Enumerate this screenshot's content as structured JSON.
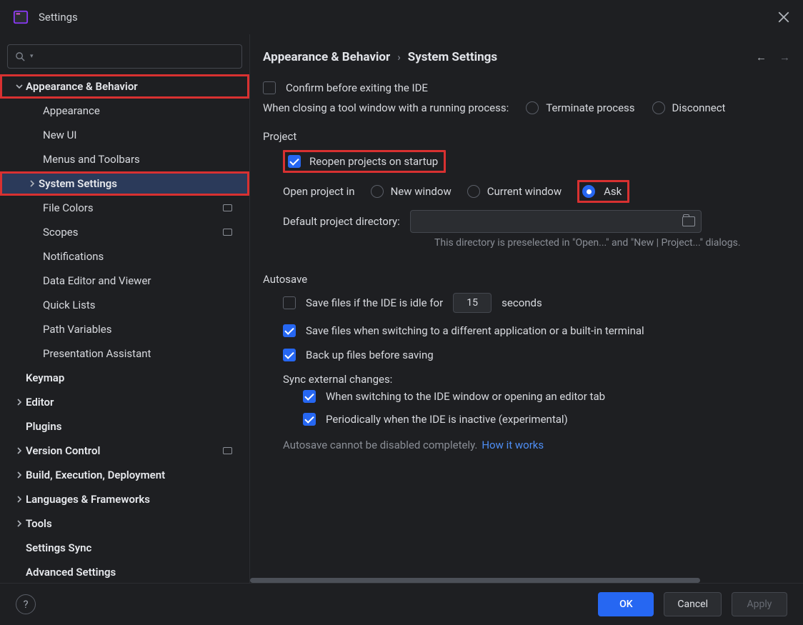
{
  "window": {
    "title": "Settings"
  },
  "sidebar": {
    "items": [
      {
        "label": "Appearance & Behavior",
        "level": 0,
        "chevron": "down",
        "highlight": true
      },
      {
        "label": "Appearance",
        "level": 1
      },
      {
        "label": "New UI",
        "level": 1
      },
      {
        "label": "Menus and Toolbars",
        "level": 1
      },
      {
        "label": "System Settings",
        "level": 1,
        "chevron": "right",
        "selected": true,
        "highlight": true,
        "boldchev": true
      },
      {
        "label": "File Colors",
        "level": 1,
        "meta": true
      },
      {
        "label": "Scopes",
        "level": 1,
        "meta": true
      },
      {
        "label": "Notifications",
        "level": 1
      },
      {
        "label": "Data Editor and Viewer",
        "level": 1
      },
      {
        "label": "Quick Lists",
        "level": 1
      },
      {
        "label": "Path Variables",
        "level": 1
      },
      {
        "label": "Presentation Assistant",
        "level": 1
      },
      {
        "label": "Keymap",
        "level": 0,
        "chevron": "none"
      },
      {
        "label": "Editor",
        "level": 0,
        "chevron": "right"
      },
      {
        "label": "Plugins",
        "level": 0,
        "chevron": "none"
      },
      {
        "label": "Version Control",
        "level": 0,
        "chevron": "right",
        "meta": true
      },
      {
        "label": "Build, Execution, Deployment",
        "level": 0,
        "chevron": "right"
      },
      {
        "label": "Languages & Frameworks",
        "level": 0,
        "chevron": "right"
      },
      {
        "label": "Tools",
        "level": 0,
        "chevron": "right"
      },
      {
        "label": "Settings Sync",
        "level": 0,
        "chevron": "none"
      },
      {
        "label": "Advanced Settings",
        "level": 0,
        "chevron": "none"
      }
    ]
  },
  "breadcrumb": {
    "root": "Appearance & Behavior",
    "leaf": "System Settings"
  },
  "settings": {
    "confirm_exit": "Confirm before exiting the IDE",
    "closing_prompt": "When closing a tool window with a running process:",
    "terminate": "Terminate process",
    "disconnect": "Disconnect",
    "project_group": "Project",
    "reopen": "Reopen projects on startup",
    "open_in": "Open project in",
    "new_window": "New window",
    "current_window": "Current window",
    "ask": "Ask",
    "default_dir_label": "Default project directory:",
    "default_dir_hint": "This directory is preselected in \"Open...\" and \"New | Project...\" dialogs.",
    "autosave_group": "Autosave",
    "save_idle": "Save files if the IDE is idle for",
    "idle_value": "15",
    "seconds": "seconds",
    "save_switch": "Save files when switching to a different application or a built-in terminal",
    "backup": "Back up files before saving",
    "sync_label": "Sync external changes:",
    "sync_switch": "When switching to the IDE window or opening an editor tab",
    "sync_periodic": "Periodically when the IDE is inactive (experimental)",
    "autosave_note": "Autosave cannot be disabled completely.",
    "how_link": "How it works"
  },
  "footer": {
    "ok": "OK",
    "cancel": "Cancel",
    "apply": "Apply"
  }
}
